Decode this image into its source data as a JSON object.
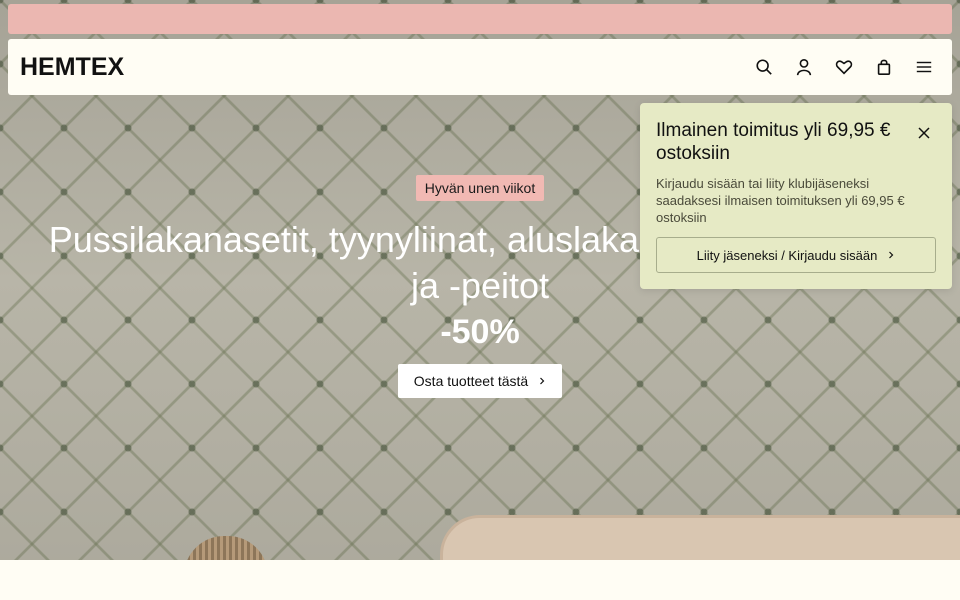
{
  "header": {
    "logo": "HEMTEX",
    "icons": [
      "search-icon",
      "account-icon",
      "heart-icon",
      "bag-icon",
      "menu-icon"
    ]
  },
  "hero": {
    "tag": "Hyvän unen viikot",
    "headline": "Pussilakanasetit, tyynyliinat, aluslakanat, untuvatyynyt ja -peitot",
    "discount": "-50%",
    "cta_label": "Osta tuotteet tästä"
  },
  "popup": {
    "title": "Ilmainen toimitus yli 69,95 € ostoksiin",
    "text": "Kirjaudu sisään tai liity klubijäseneksi saadaksesi ilmaisen toimituksen yli 69,95 € ostoksiin",
    "button_label": "Liity jäseneksi / Kirjaudu sisään"
  },
  "colors": {
    "banner": "#ebb7b1",
    "tag": "#f1b9b3",
    "popup": "#e6eac5",
    "header": "#fffdf4"
  }
}
